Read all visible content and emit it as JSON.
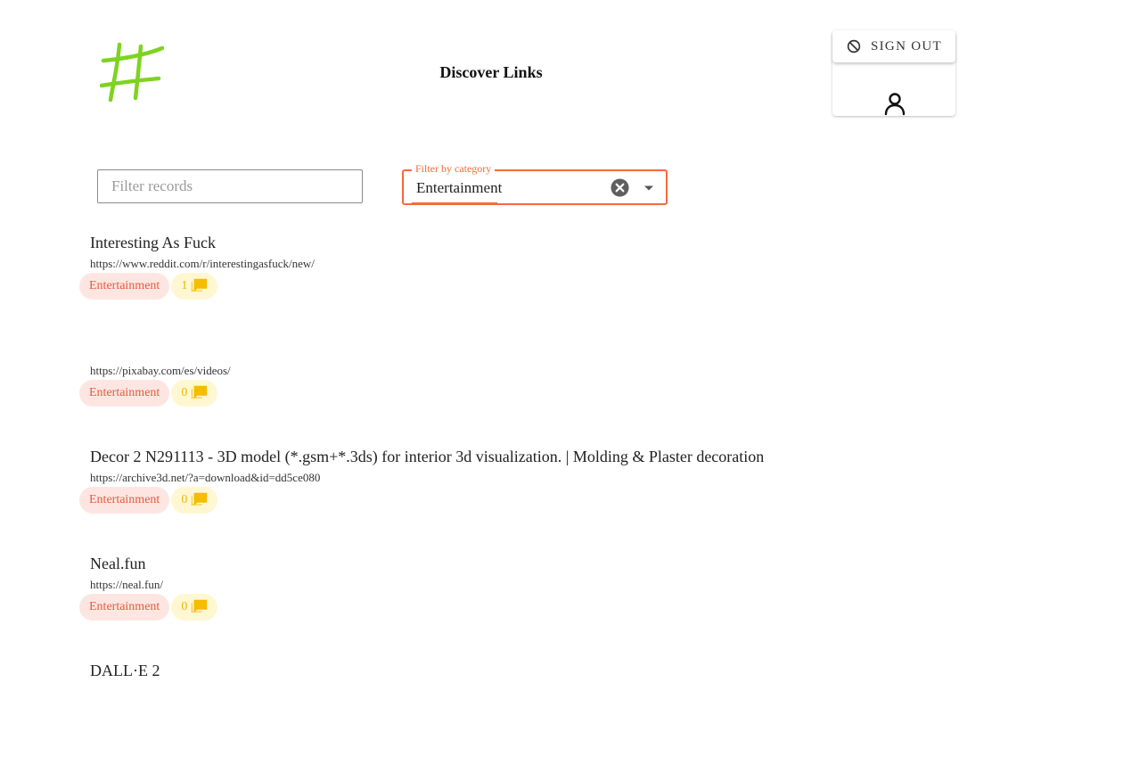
{
  "header": {
    "title": "Discover Links",
    "logo_icon": "hashtag-scribble-icon",
    "logo_color": "#7ed321"
  },
  "account": {
    "signout_label": "SIGN OUT",
    "signout_icon": "block-icon",
    "user_icon": "user-icon"
  },
  "filters": {
    "search_placeholder": "Filter records",
    "search_value": "",
    "category_label": "Filter by category",
    "category_value": "Entertainment",
    "accent_color": "#f26b3a"
  },
  "records": [
    {
      "title": "Interesting As Fuck",
      "url": "https://www.reddit.com/r/interestingasfuck/new/",
      "category": "Entertainment",
      "comments": "1"
    },
    {
      "title": "",
      "url": "https://pixabay.com/es/videos/",
      "category": "Entertainment",
      "comments": "0"
    },
    {
      "title": "Decor 2 N291113 - 3D model (*.gsm+*.3ds) for interior 3d visualization. | Molding & Plaster decoration",
      "url": "https://archive3d.net/?a=download&id=dd5ce080",
      "category": "Entertainment",
      "comments": "0"
    },
    {
      "title": "Neal.fun",
      "url": "https://neal.fun/",
      "category": "Entertainment",
      "comments": "0"
    },
    {
      "title": "DALL·E 2",
      "url": "",
      "category": "",
      "comments": ""
    }
  ]
}
